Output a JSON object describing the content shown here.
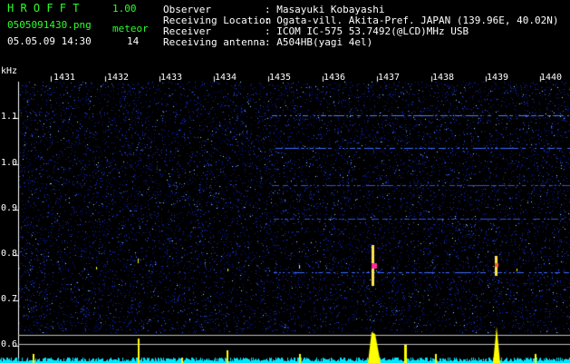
{
  "app": {
    "name": "H R O F F T",
    "version": "1.00"
  },
  "file": {
    "name": "0505091430.png",
    "datetime": "05.05.09 14:30"
  },
  "meteor": {
    "label": "meteor",
    "count": "14"
  },
  "info": [
    {
      "key": "Observer",
      "value": ": Masayuki Kobayashi"
    },
    {
      "key": "Receiving Location",
      "value": ": Ogata-vill. Akita-Pref. JAPAN (139.96E, 40.02N)"
    },
    {
      "key": "Receiver",
      "value": ": ICOM IC-575 53.7492(@LCD)MHz USB"
    },
    {
      "key": "Receiving antenna",
      "value": ": A504HB(yagi 4el)"
    }
  ],
  "axis": {
    "y_unit": "kHz",
    "y_ticks": [
      "1.1",
      "1.0",
      "0.9",
      "0.8",
      "0.7",
      "0.6"
    ],
    "time_ticks": [
      "1431",
      "1432",
      "1433",
      "1434",
      "1435",
      "1436",
      "1437",
      "1438",
      "1439",
      "1440"
    ]
  },
  "colors": {
    "header_green": "#2bff2b",
    "noise_blue": "#1a2fd0",
    "echo_yellow": "#ffff00",
    "baseline_cyan": "#00e5ff",
    "echo_magenta": "#ff2a9a"
  }
}
